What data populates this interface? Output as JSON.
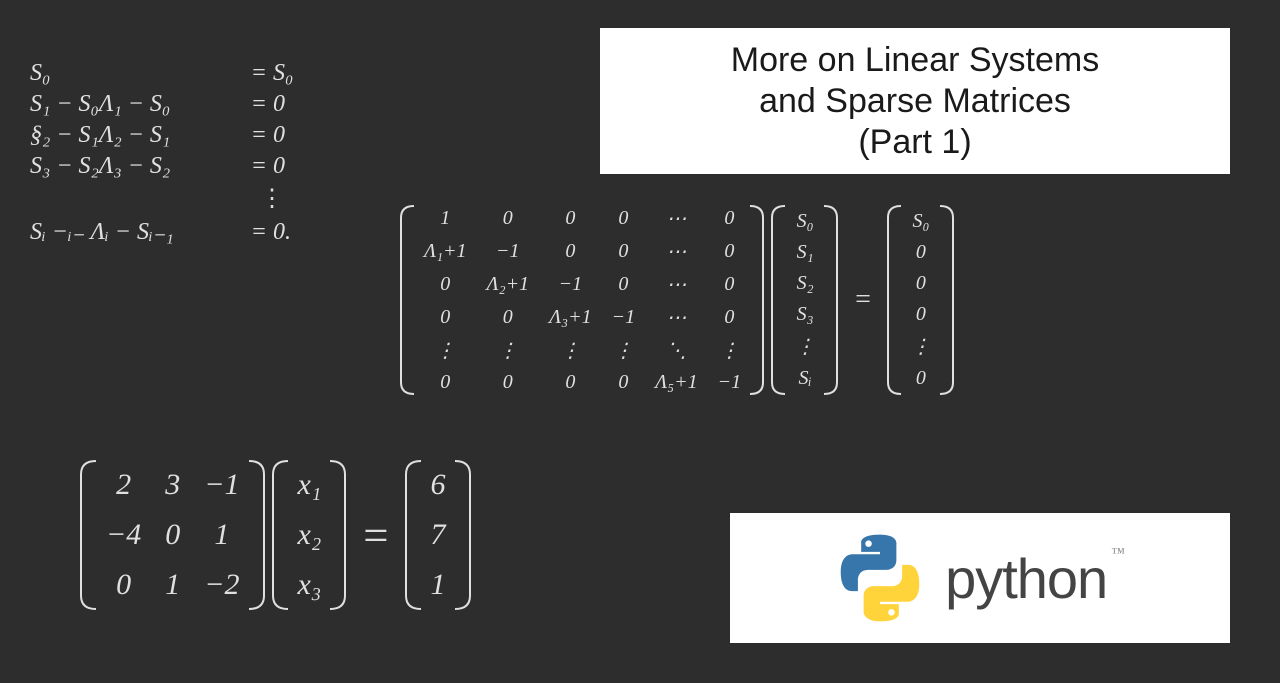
{
  "title": {
    "line1": "More on Linear Systems",
    "line2": "and Sparse Matrices",
    "line3": "(Part 1)"
  },
  "equations": {
    "rows": [
      {
        "lhs": "S₀",
        "rhs": "S₀"
      },
      {
        "lhs": "S₁ − S₀Λ₁ − S₀",
        "rhs": "0"
      },
      {
        "lhs": "§₂ − S₁Λ₂ − S₁",
        "rhs": "0"
      },
      {
        "lhs": "S₃ − S₂Λ₃ − S₂",
        "rhs": "0"
      }
    ],
    "vdots": "⋮",
    "last": {
      "lhs": "Sᵢ −ᵢ₋ Λᵢ − Sᵢ₋₁",
      "rhs": "0."
    }
  },
  "bigMatrix": {
    "A": [
      [
        "1",
        "0",
        "0",
        "0",
        "⋯",
        "0"
      ],
      [
        "Λ₁+1",
        "−1",
        "0",
        "0",
        "⋯",
        "0"
      ],
      [
        "0",
        "Λ₂+1",
        "−1",
        "0",
        "⋯",
        "0"
      ],
      [
        "0",
        "0",
        "Λ₃+1",
        "−1",
        "⋯",
        "0"
      ],
      [
        "⋮",
        "⋮",
        "⋮",
        "⋮",
        "⋱",
        "⋮"
      ],
      [
        "0",
        "0",
        "0",
        "0",
        "Λ₅+1",
        "−1"
      ]
    ],
    "x": [
      "S₀",
      "S₁",
      "S₂",
      "S₃",
      "⋮",
      "Sᵢ"
    ],
    "b": [
      "S₀",
      "0",
      "0",
      "0",
      "⋮",
      "0"
    ]
  },
  "smallMatrix": {
    "A": [
      [
        "2",
        "3",
        "−1"
      ],
      [
        "−4",
        "0",
        "1"
      ],
      [
        "0",
        "1",
        "−2"
      ]
    ],
    "x": [
      "x₁",
      "x₂",
      "x₃"
    ],
    "b": [
      "6",
      "7",
      "1"
    ]
  },
  "python": {
    "label": "python",
    "tm": "™"
  }
}
